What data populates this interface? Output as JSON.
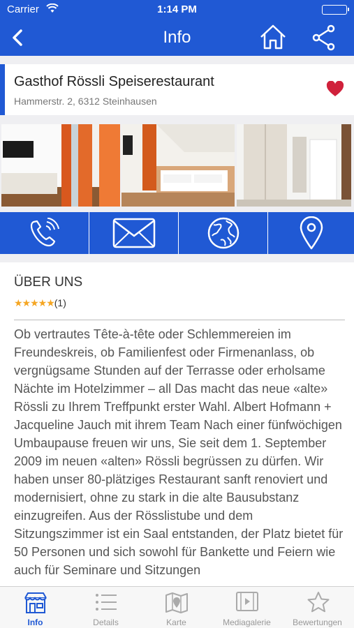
{
  "status_bar": {
    "carrier": "Carrier",
    "time": "1:14 PM"
  },
  "nav": {
    "title": "Info",
    "back_icon": "chevron-left-icon",
    "home_icon": "home-icon",
    "share_icon": "share-icon"
  },
  "place": {
    "name": "Gasthof Rössli Speiserestaurant",
    "address": "Hammerstr. 2, 6312 Steinhausen",
    "favorite_icon": "heart-icon",
    "favorite_color": "#d0213b"
  },
  "actions": [
    {
      "name": "call",
      "icon": "phone-icon"
    },
    {
      "name": "email",
      "icon": "envelope-icon"
    },
    {
      "name": "website",
      "icon": "globe-icon"
    },
    {
      "name": "location",
      "icon": "map-pin-icon"
    }
  ],
  "about": {
    "title": "ÜBER UNS",
    "rating_stars": "★★★★★",
    "rating_count": "(1)",
    "text": "Ob vertrautes Tête-à-tête oder Schlemmereien im Freundeskreis, ob Familienfest oder Firmenanlass, ob vergnügsame Stunden auf der Terrasse oder erholsame Nächte im Hotelzimmer – all Das macht das neue «alte» Rössli zu Ihrem Treffpunkt erster Wahl. Albert Hofmann + Jacqueline Jauch mit ihrem Team Nach einer fünfwöchigen Umbaupause freuen wir uns, Sie seit dem 1. September 2009 im neuen «alten» Rössli begrüssen zu dürfen. Wir haben unser 80-plätziges Restaurant sanft renoviert und modernisiert, ohne zu stark in die alte Bausubstanz einzugreifen. Aus der Rösslistube und dem Sitzungszimmer ist ein Saal entstanden, der Platz bietet für 50 Personen und sich sowohl für Bankette und Feiern wie auch für Seminare und Sitzungen"
  },
  "tabs": [
    {
      "label": "Info",
      "icon": "shop-icon",
      "active": true
    },
    {
      "label": "Details",
      "icon": "list-icon",
      "active": false
    },
    {
      "label": "Karte",
      "icon": "map-icon",
      "active": false
    },
    {
      "label": "Mediagalerie",
      "icon": "film-icon",
      "active": false
    },
    {
      "label": "Bewertungen",
      "icon": "star-icon",
      "active": false
    }
  ],
  "colors": {
    "brand_blue": "#2059d4",
    "star": "#f5a623"
  }
}
